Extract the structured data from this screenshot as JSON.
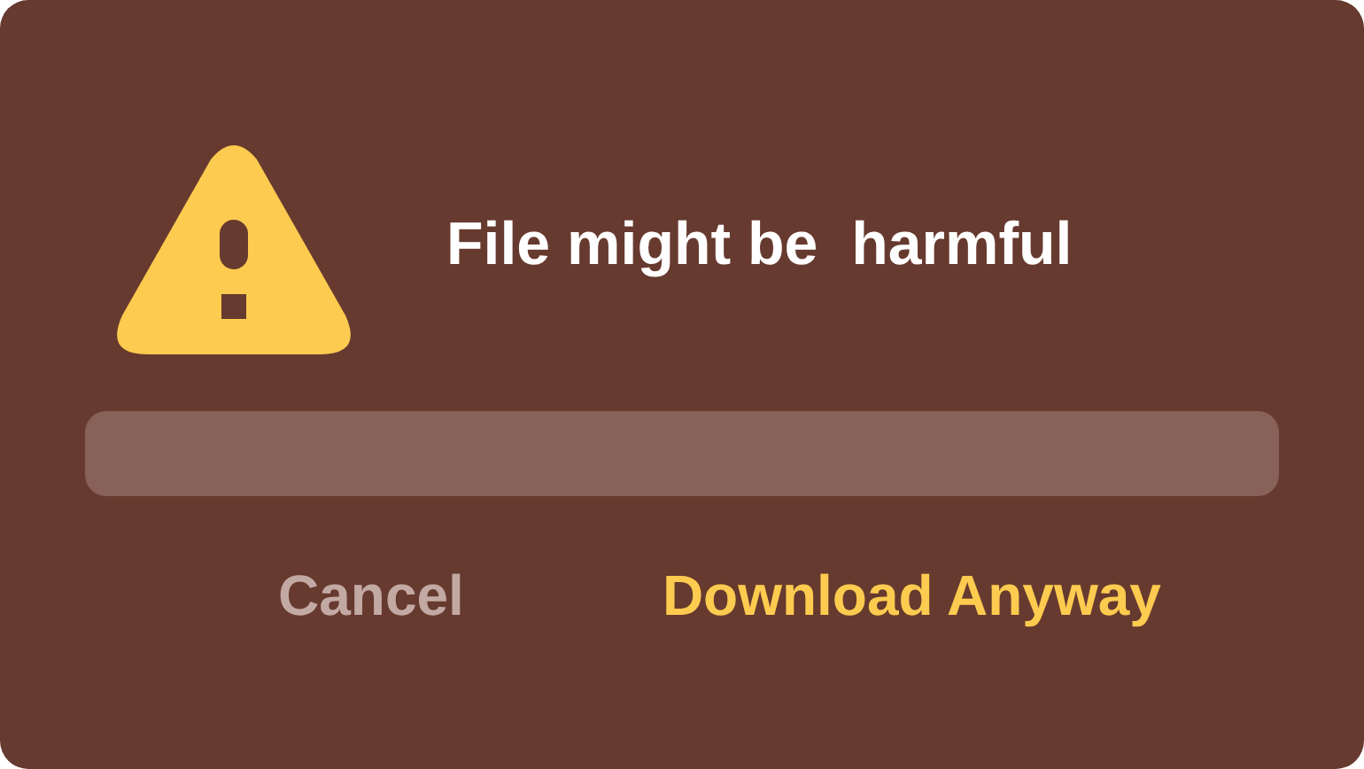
{
  "dialog": {
    "title": "File might be  harmful",
    "buttons": [
      {
        "label": "Cancel",
        "kind": "secondary"
      },
      {
        "label": "Download Anyway",
        "kind": "primary"
      }
    ]
  }
}
